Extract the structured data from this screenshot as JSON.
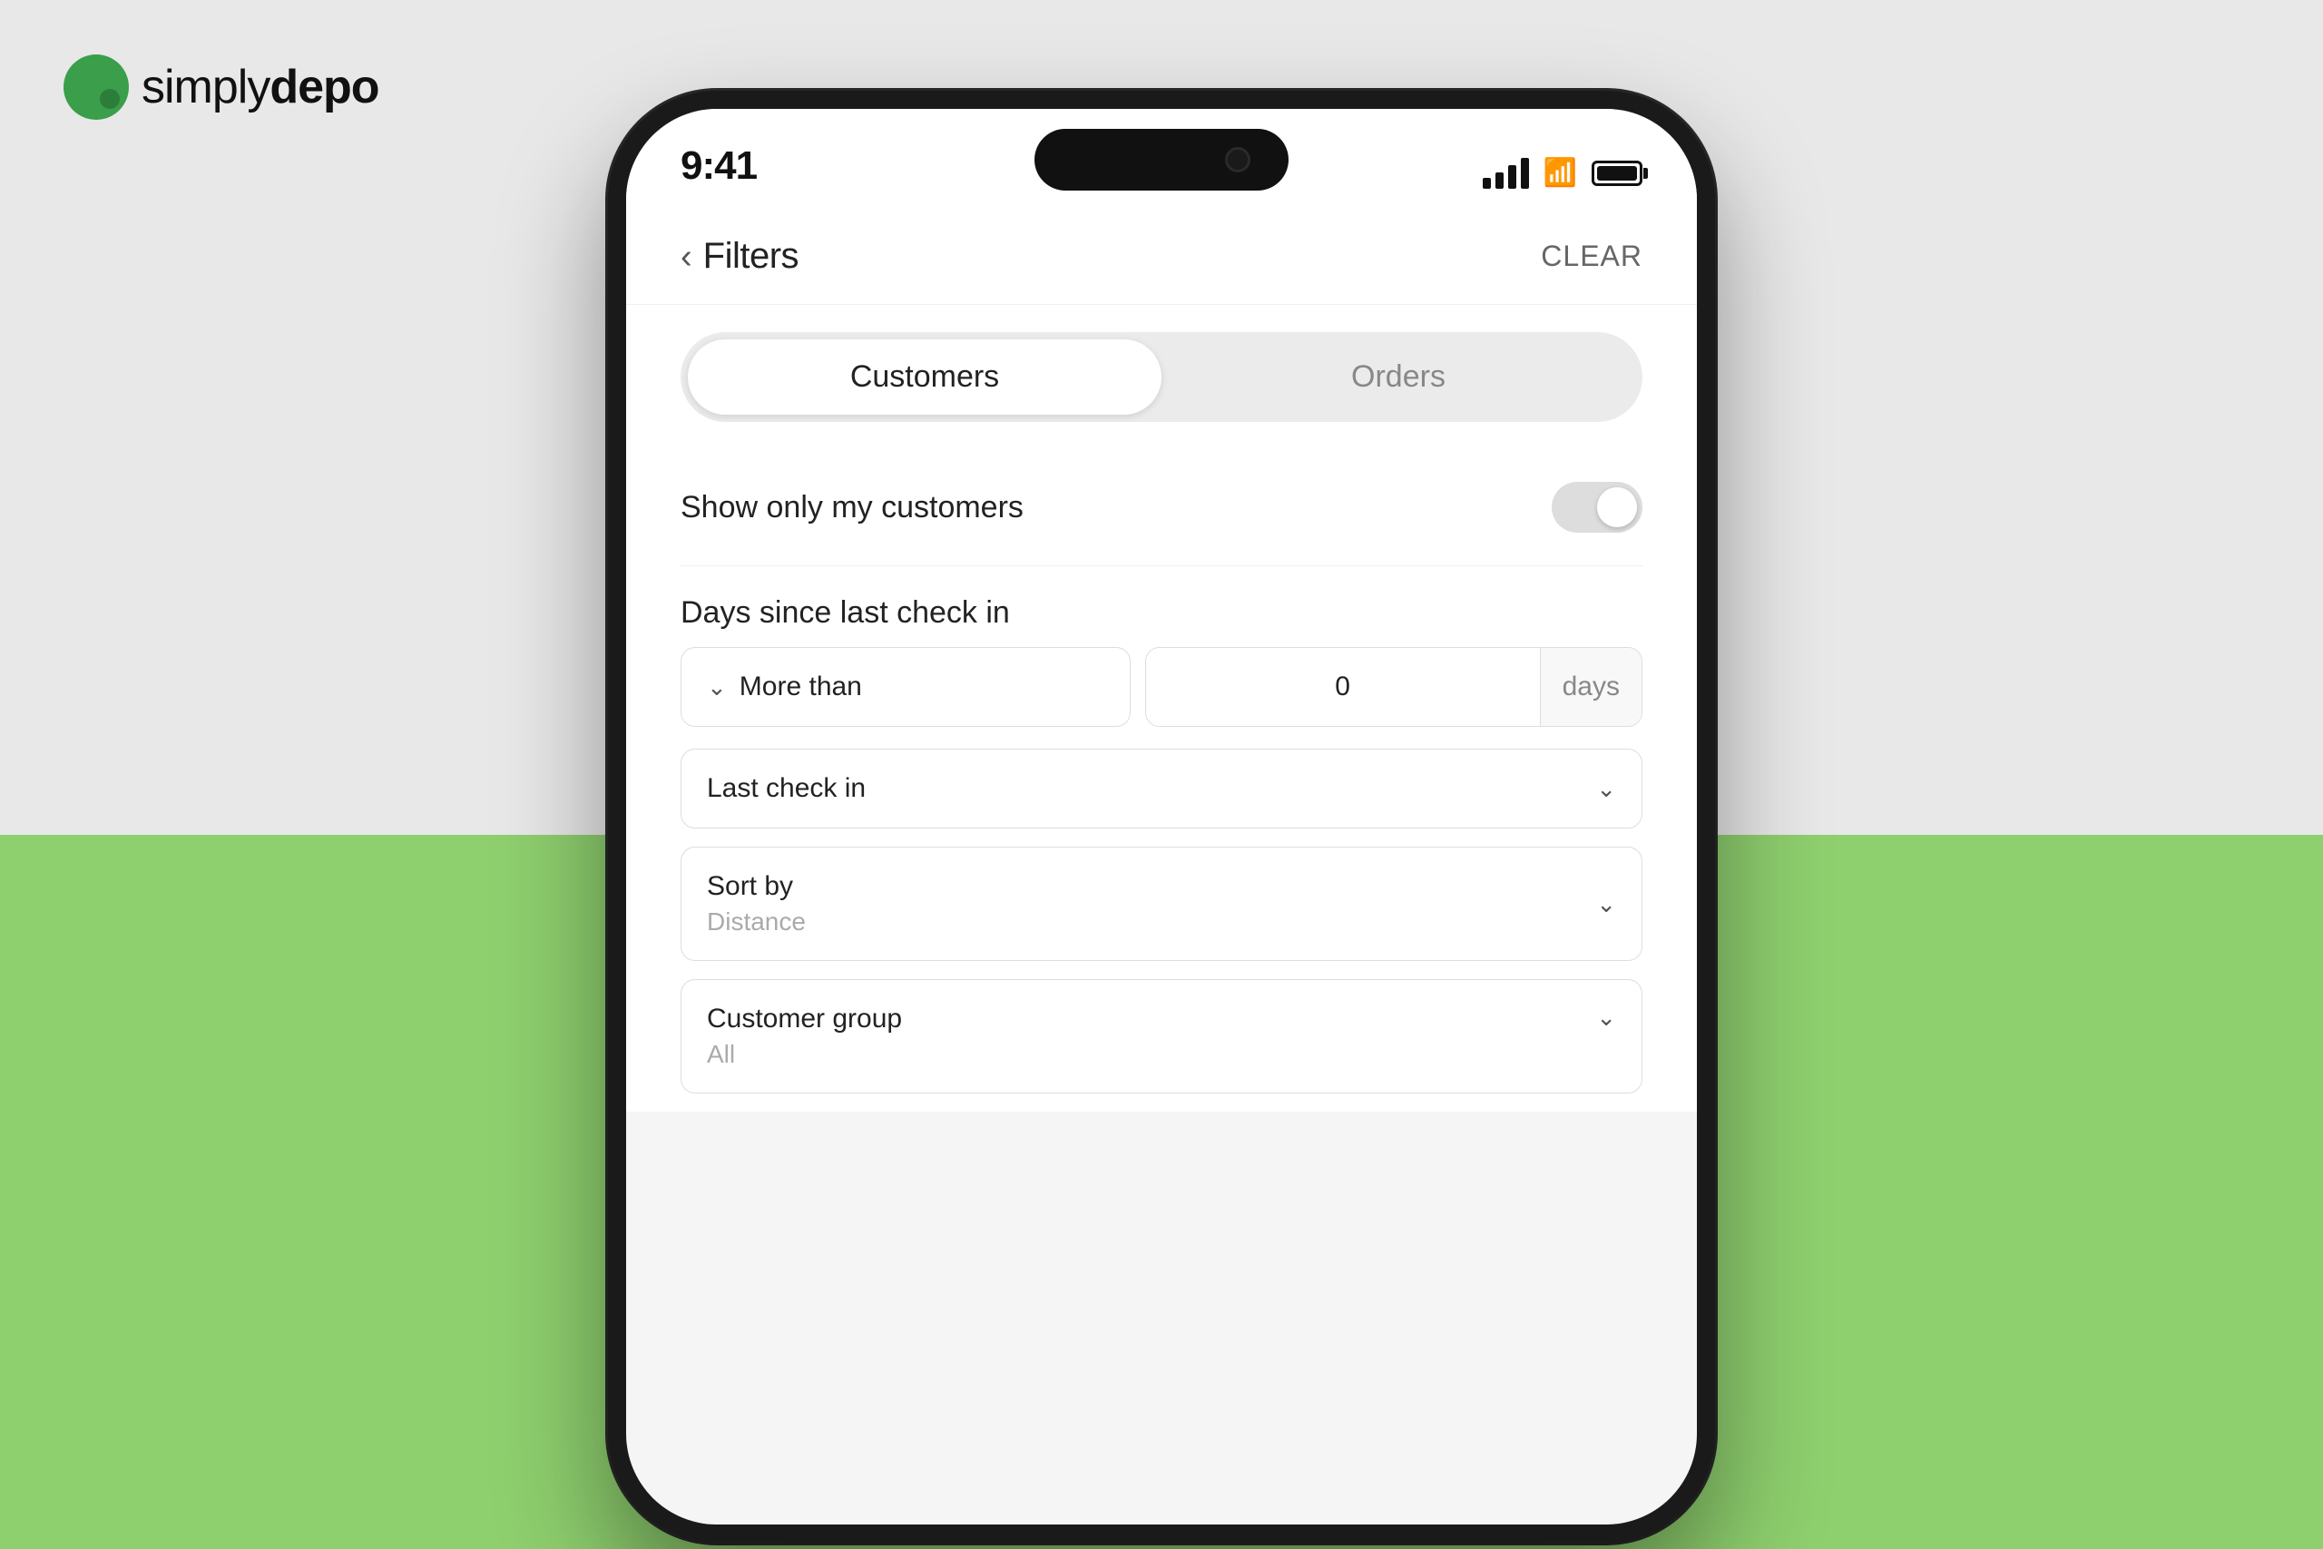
{
  "logo": {
    "text_plain": "simply",
    "text_bold": "depo"
  },
  "status_bar": {
    "time": "9:41"
  },
  "header": {
    "back_label": "‹",
    "title": "Filters",
    "clear_label": "CLEAR"
  },
  "tabs": {
    "customers_label": "Customers",
    "orders_label": "Orders"
  },
  "toggle_row": {
    "label": "Show only my customers"
  },
  "days_section": {
    "title": "Days since last check in",
    "more_than_label": "More than",
    "days_value": "0",
    "days_unit": "days"
  },
  "last_check_in": {
    "label": "Last check in"
  },
  "sort_by": {
    "label": "Sort by",
    "value": "Distance"
  },
  "customer_group": {
    "label": "Customer group",
    "value": "All"
  }
}
